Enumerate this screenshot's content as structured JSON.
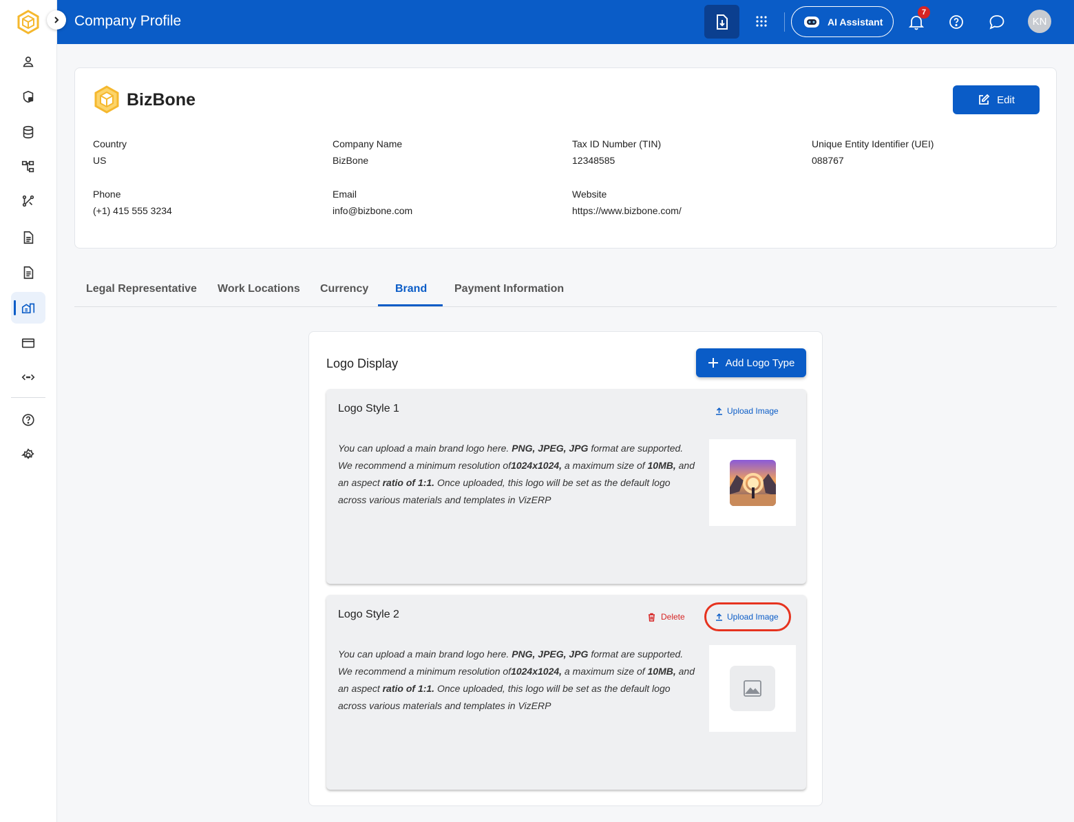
{
  "app": {
    "page_title": "Company Profile"
  },
  "topbar": {
    "ai_assistant_label": "AI Assistant",
    "notification_count": "7",
    "avatar_initials": "KN"
  },
  "company": {
    "name": "BizBone",
    "edit_label": "Edit",
    "fields": [
      {
        "label": "Country",
        "value": "US"
      },
      {
        "label": "Company Name",
        "value": "BizBone"
      },
      {
        "label": "Tax ID Number (TIN)",
        "value": "12348585"
      },
      {
        "label": "Unique Entity Identifier (UEI)",
        "value": "088767"
      },
      {
        "label": "Phone",
        "value": "(+1) 415 555 3234"
      },
      {
        "label": "Email",
        "value": "info@bizbone.com"
      },
      {
        "label": "Website",
        "value": "https://www.bizbone.com/"
      }
    ]
  },
  "tabs": [
    {
      "label": "Legal Representative"
    },
    {
      "label": "Work Locations"
    },
    {
      "label": "Currency"
    },
    {
      "label": "Brand",
      "active": true
    },
    {
      "label": "Payment Information"
    }
  ],
  "logo_display": {
    "title": "Logo Display",
    "add_label": "Add Logo Type",
    "styles": [
      {
        "title": "Logo Style 1",
        "upload_label": "Upload Image",
        "desc": {
          "p1": "You can upload a main brand logo here. ",
          "b1": "PNG, JPEG, JPG",
          "p2": " format are supported. We recommend a minimum resolution of",
          "b2": "1024x1024,",
          "p3": " a maximum size of ",
          "b3": "10MB,",
          "p4": " and an aspect ",
          "b4": "ratio of 1:1.",
          "p5": " Once uploaded, this logo will be set as the default logo across various materials and templates in VizERP"
        }
      },
      {
        "title": "Logo Style 2",
        "delete_label": "Delete",
        "upload_label": "Upload Image",
        "desc": {
          "p1": "You can upload a main brand logo here. ",
          "b1": "PNG, JPEG, JPG",
          "p2": " format are supported. We recommend a minimum resolution of",
          "b2": "1024x1024,",
          "p3": " a maximum size of ",
          "b3": "10MB,",
          "p4": " and an aspect ",
          "b4": "ratio of 1:1.",
          "p5": " Once uploaded, this logo will be set as the default logo across various materials and templates in VizERP"
        }
      }
    ]
  },
  "colors": {
    "brand": "#0a5cc7",
    "danger": "#d62424",
    "logo_yellow": "#f5b82e"
  },
  "sidebar": {
    "icons": [
      "user-icon",
      "shield-lock-icon",
      "database-icon",
      "hierarchy-icon",
      "workflow-icon",
      "document-icon",
      "document-list-icon",
      "company-building-icon",
      "credit-card-icon",
      "api-icon",
      "help-icon",
      "settings-icon"
    ]
  }
}
